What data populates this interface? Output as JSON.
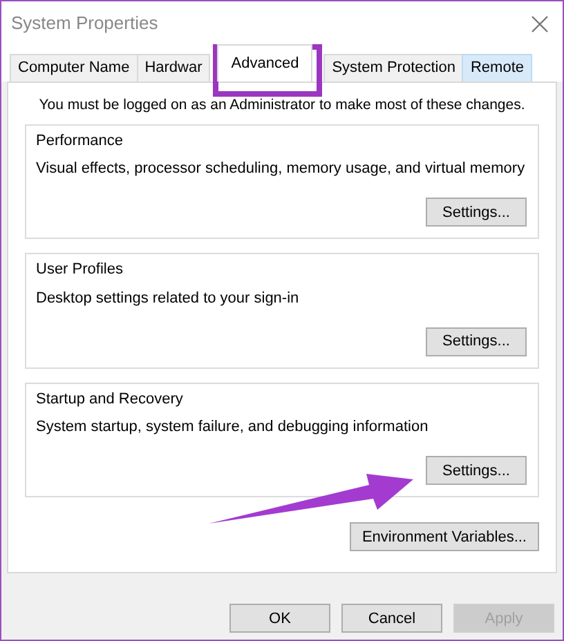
{
  "window": {
    "title": "System Properties"
  },
  "tabs": [
    {
      "label": "Computer Name",
      "selected": false,
      "hovered": false
    },
    {
      "label": "Hardwar",
      "selected": false,
      "hovered": false
    },
    {
      "label": "Advanced",
      "selected": true,
      "hovered": false
    },
    {
      "label": "System Protection",
      "selected": false,
      "hovered": false
    },
    {
      "label": "Remote",
      "selected": false,
      "hovered": true
    }
  ],
  "notice": "You must be logged on as an Administrator to make most of these changes.",
  "groups": [
    {
      "title": "Performance",
      "description": "Visual effects, processor scheduling, memory usage, and virtual memory",
      "button": "Settings..."
    },
    {
      "title": "User Profiles",
      "description": "Desktop settings related to your sign-in",
      "button": "Settings..."
    },
    {
      "title": "Startup and Recovery",
      "description": "System startup, system failure, and debugging information",
      "button": "Settings..."
    }
  ],
  "environment_button": "Environment Variables...",
  "footer_buttons": [
    {
      "label": "OK",
      "disabled": false
    },
    {
      "label": "Cancel",
      "disabled": false
    },
    {
      "label": "Apply",
      "disabled": true
    }
  ]
}
